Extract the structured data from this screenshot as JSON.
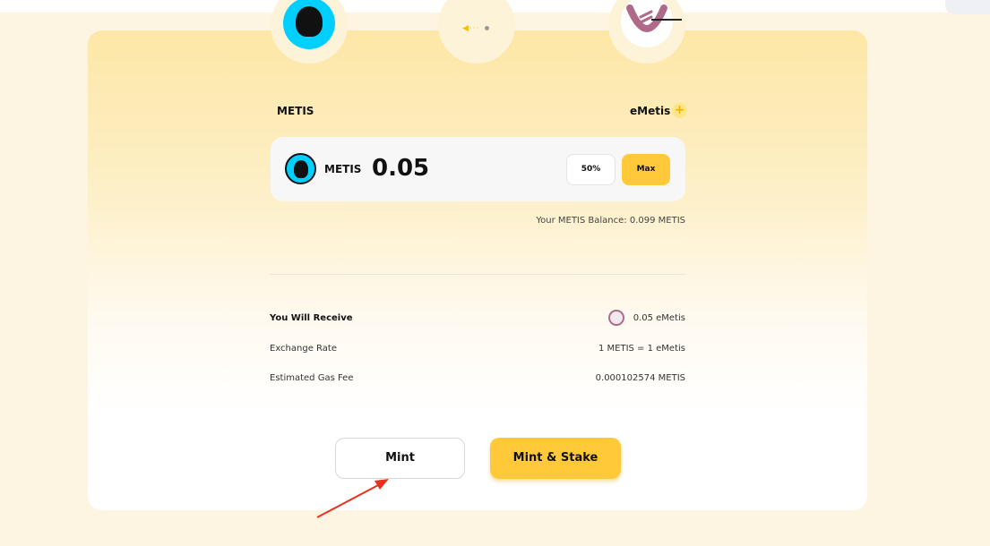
{
  "tokens": {
    "from_name": "METIS",
    "to_name": "eMetis"
  },
  "input": {
    "token_label": "METIS",
    "amount": "0.05",
    "btn_half": "50%",
    "btn_max": "Max"
  },
  "balance_text": "Your METIS Balance: 0.099 METIS",
  "summary": {
    "receive_label": "You Will Receive",
    "receive_value": "0.05 eMetis",
    "rate_label": "Exchange Rate",
    "rate_value": "1 METIS = 1 eMetis",
    "gas_label": "Estimated Gas Fee",
    "gas_value": "0.000102574 METIS"
  },
  "actions": {
    "mint_label": "Mint",
    "mint_stake_label": "Mint & Stake"
  },
  "colors": {
    "accent": "#ffc93a",
    "metis_brand": "#00cfff",
    "emetis_brand": "#b06a89",
    "annotation_arrow": "#e8321e"
  },
  "icons": [
    "metis-token-icon",
    "emetis-token-icon",
    "swap-direction-icon",
    "plus-icon"
  ]
}
